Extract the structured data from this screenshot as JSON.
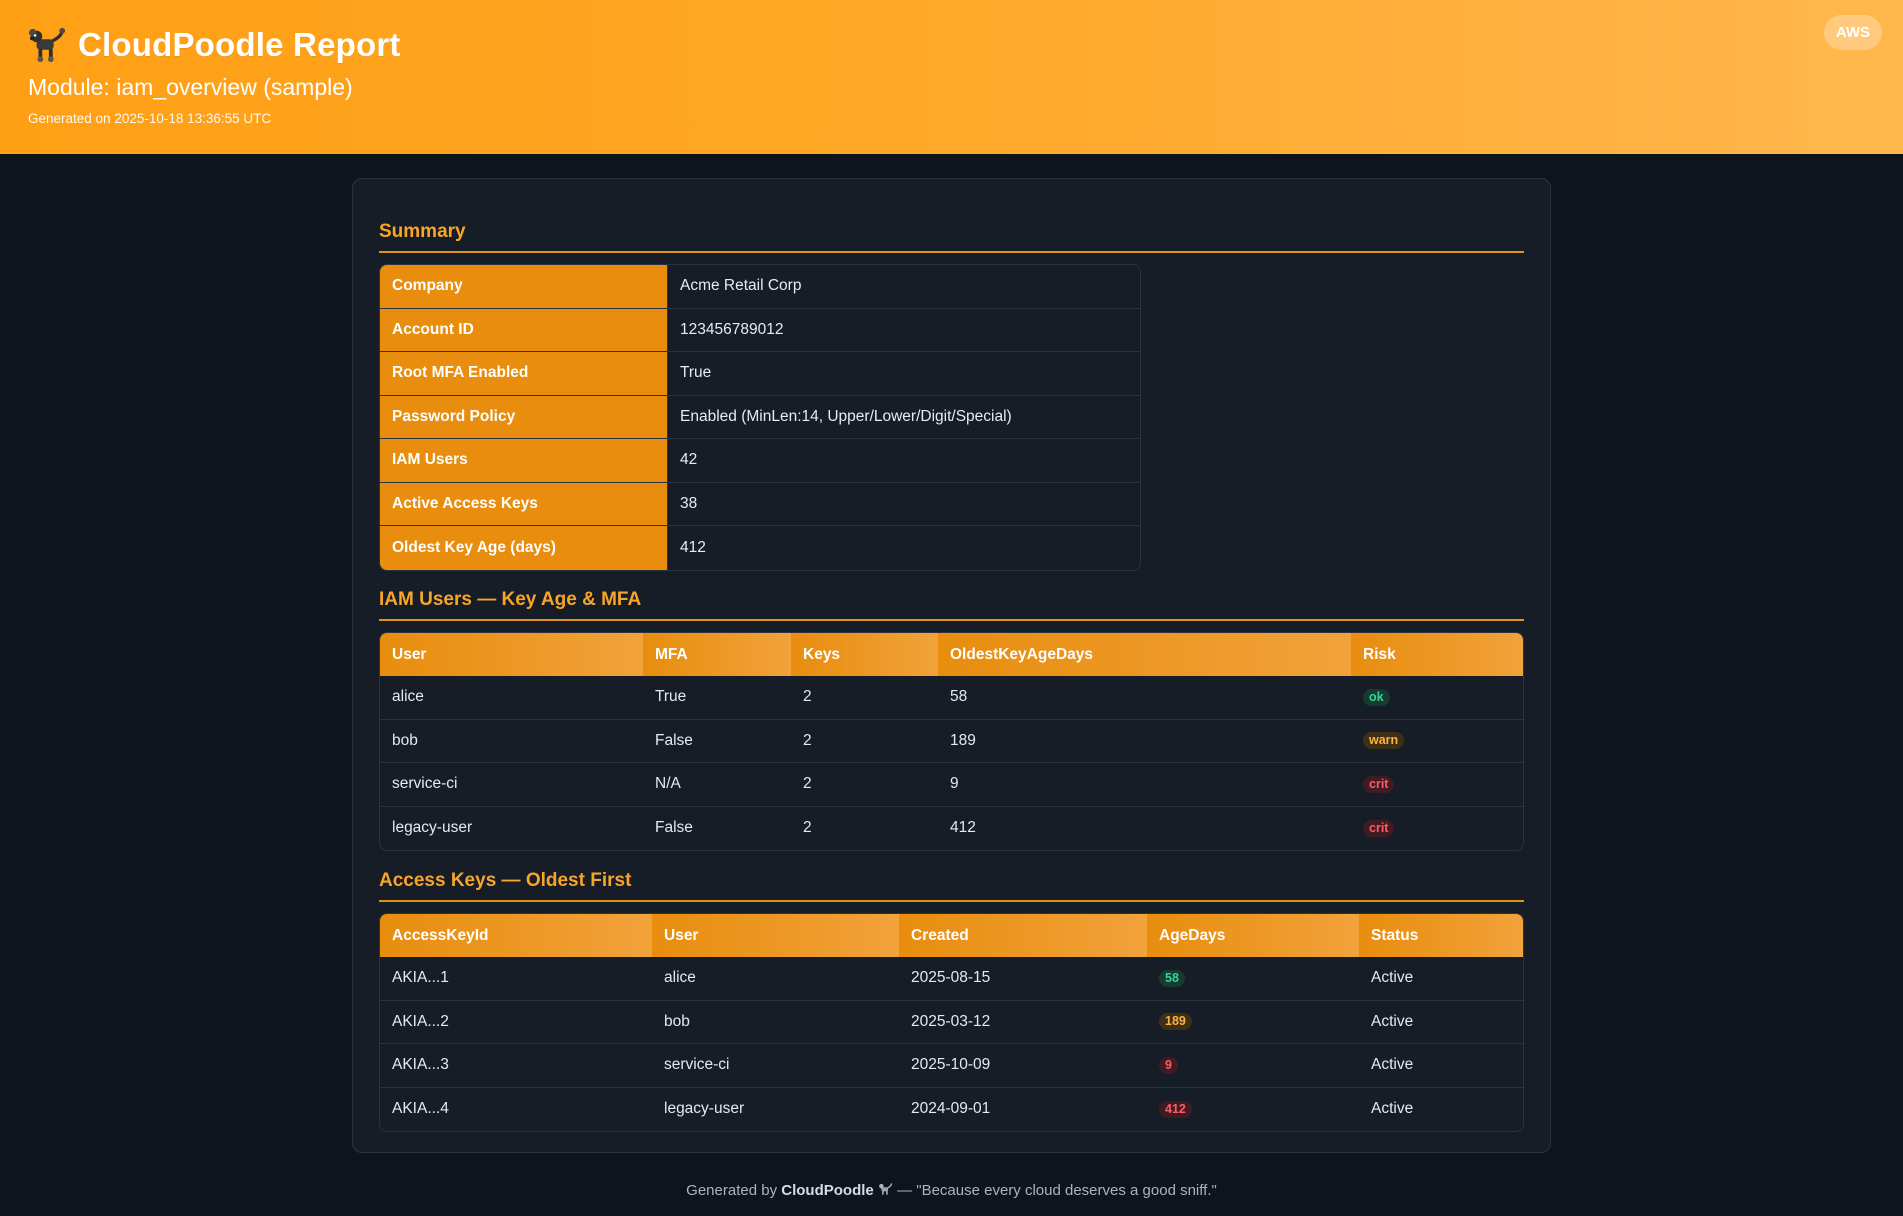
{
  "header": {
    "title": "CloudPoodle Report",
    "module": "Module: iam_overview (sample)",
    "generated": "Generated on 2025-10-18 13:36:55 UTC",
    "provider_badge": "AWS"
  },
  "summary": {
    "title": "Summary",
    "rows": [
      {
        "key": "Company",
        "value": "Acme Retail Corp"
      },
      {
        "key": "Account ID",
        "value": "123456789012"
      },
      {
        "key": "Root MFA Enabled",
        "value": "True"
      },
      {
        "key": "Password Policy",
        "value": "Enabled (MinLen:14, Upper/Lower/Digit/Special)"
      },
      {
        "key": "IAM Users",
        "value": "42"
      },
      {
        "key": "Active Access Keys",
        "value": "38"
      },
      {
        "key": "Oldest Key Age (days)",
        "value": "412"
      }
    ]
  },
  "users": {
    "title": "IAM Users — Key Age & MFA",
    "columns": [
      "User",
      "MFA",
      "Keys",
      "OldestKeyAgeDays",
      "Risk"
    ],
    "rows": [
      {
        "user": "alice",
        "mfa": "True",
        "keys": "2",
        "age": "58",
        "risk": "ok"
      },
      {
        "user": "bob",
        "mfa": "False",
        "keys": "2",
        "age": "189",
        "risk": "warn"
      },
      {
        "user": "service-ci",
        "mfa": "N/A",
        "keys": "2",
        "age": "9",
        "risk": "crit"
      },
      {
        "user": "legacy-user",
        "mfa": "False",
        "keys": "2",
        "age": "412",
        "risk": "crit"
      }
    ]
  },
  "keys": {
    "title": "Access Keys — Oldest First",
    "columns": [
      "AccessKeyId",
      "User",
      "Created",
      "AgeDays",
      "Status"
    ],
    "rows": [
      {
        "id": "AKIA...1",
        "user": "alice",
        "created": "2025-08-15",
        "age": "58",
        "level": "ok",
        "status": "Active"
      },
      {
        "id": "AKIA...2",
        "user": "bob",
        "created": "2025-03-12",
        "age": "189",
        "level": "warn",
        "status": "Active"
      },
      {
        "id": "AKIA...3",
        "user": "service-ci",
        "created": "2025-10-09",
        "age": "9",
        "level": "crit",
        "status": "Active"
      },
      {
        "id": "AKIA...4",
        "user": "legacy-user",
        "created": "2024-09-01",
        "age": "412",
        "level": "crit",
        "status": "Active"
      }
    ]
  },
  "footer": {
    "prefix": "Generated by",
    "brand": "CloudPoodle",
    "icon": "dog-icon",
    "suffix": "— \"Because every cloud deserves a good sniff.\""
  },
  "colors": {
    "accent": "#f7a528",
    "header_start": "#ff9f14",
    "header_end": "#ffb74d",
    "ok": "#35d39a",
    "warn": "#ffb23a",
    "crit": "#ff5a6a"
  }
}
